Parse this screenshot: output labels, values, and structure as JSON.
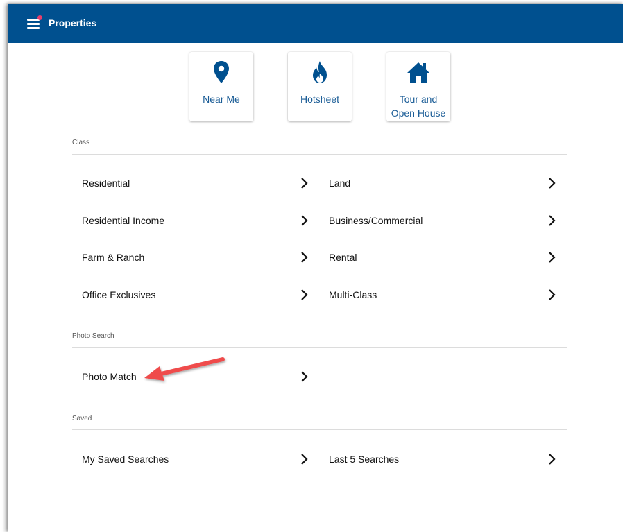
{
  "app": {
    "title": "Properties"
  },
  "colors": {
    "appbar": "#00508f",
    "accent_text": "#1a5c96",
    "notification_dot": "#e83e6b",
    "callout_arrow": "#ef4b4b"
  },
  "quick_actions": [
    {
      "label_line1": "Near Me",
      "label_line2": "",
      "icon": "map-pin-icon"
    },
    {
      "label_line1": "Hotsheet",
      "label_line2": "",
      "icon": "flame-icon"
    },
    {
      "label_line1": "Tour and",
      "label_line2": "Open House",
      "icon": "house-icon"
    }
  ],
  "sections": {
    "class": {
      "title": "Class",
      "items": [
        {
          "label": "Residential"
        },
        {
          "label": "Land"
        },
        {
          "label": "Residential Income"
        },
        {
          "label": "Business/Commercial"
        },
        {
          "label": "Farm & Ranch"
        },
        {
          "label": "Rental"
        },
        {
          "label": "Office Exclusives"
        },
        {
          "label": "Multi-Class"
        }
      ]
    },
    "photo_search": {
      "title": "Photo Search",
      "items": [
        {
          "label": "Photo Match"
        }
      ]
    },
    "saved": {
      "title": "Saved",
      "items": [
        {
          "label": "My Saved Searches"
        },
        {
          "label": "Last 5 Searches"
        }
      ]
    }
  }
}
